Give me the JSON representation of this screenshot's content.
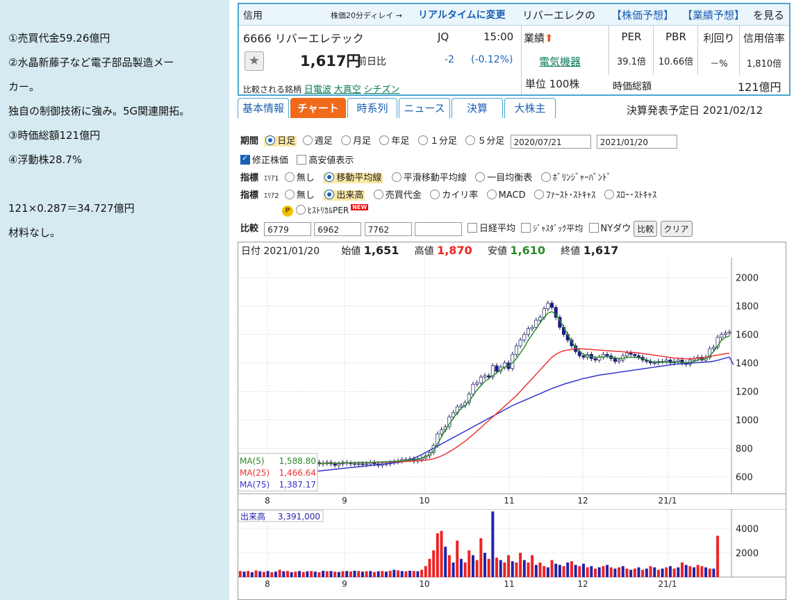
{
  "notes": {
    "line1": "①売買代金59.26億円",
    "line2": "②水晶新藤子など電子部品製造メー",
    "line3": "カー。",
    "line4": "独自の制御技術に強み。5G関連開拓。",
    "line5": "③時価総額121億円",
    "line6": "④浮動株28.7%",
    "line7": "121×0.287＝34.727億円",
    "line8": "材料なし。"
  },
  "header": {
    "shinyo": "信用",
    "delay": "株価20分ディレイ →",
    "realtime": "リアルタイムに変更",
    "river": "リバーエレクの",
    "kabuka_yosou": "【株価予想】",
    "gyouseki_yosou": "【業績予想】",
    "miru": "を見る"
  },
  "stock": {
    "code_name": "6666 リバーエレテック",
    "market": "JQ",
    "time": "15:00",
    "price": "1,617円",
    "zenjitsu": "前日比",
    "change": "-2",
    "change_pct": "(-0.12%)",
    "hikaku_label": "比較される銘柄",
    "peers": [
      "日電波",
      "大真空",
      "シチズン"
    ],
    "gyouseki": "業績",
    "sector": "電気機器",
    "tani": "単位 100株",
    "jika_label": "時価総額",
    "jika_value": "121億円"
  },
  "ratios": [
    {
      "label": "PER",
      "value": "39.1倍"
    },
    {
      "label": "PBR",
      "value": "10.66倍"
    },
    {
      "label": "利回り",
      "value": "－%"
    },
    {
      "label": "信用倍率",
      "value": "1,810倍"
    }
  ],
  "tabs": [
    "基本情報",
    "チャート",
    "時系列",
    "ニュース",
    "決算",
    "大株主"
  ],
  "kessan_date": "決算発表予定日 2021/02/12",
  "controls": {
    "kikan_label": "期間",
    "periods": [
      "日足",
      "週足",
      "月足",
      "年足",
      "１分足",
      "５分足"
    ],
    "date_from": "2020/07/21",
    "date_to": "2021/01/20",
    "shusei": "修正株価",
    "takayasu": "高安値表示",
    "shihyo_label": "指標",
    "area1": "ｴﾘｱ1",
    "area1_opts": [
      "無し",
      "移動平均線",
      "平滑移動平均線",
      "一目均衡表",
      "ﾎﾞﾘﾝｼﾞｬｰﾊﾞﾝﾄﾞ"
    ],
    "area2": "ｴﾘｱ2",
    "area2_opts": [
      "無し",
      "出来高",
      "売買代金",
      "カイリ率",
      "MACD",
      "ﾌｧｰｽﾄ･ｽﾄｷｬｽ",
      "ｽﾛｰ･ｽﾄｷｬｽ"
    ],
    "hist_per": "ﾋｽﾄﾘｶﾙPER",
    "new": "NEW",
    "hikaku_label": "比較",
    "hikaku_codes": [
      "6779",
      "6962",
      "7762",
      ""
    ],
    "nikkei": "日経平均",
    "jasdaq": "ｼﾞｬｽﾀﾞｯｸ平均",
    "nydow": "NYダウ",
    "hikaku_btn": "比較",
    "clear_btn": "クリア"
  },
  "ohlc": {
    "date_label": "日付",
    "date": "2021/01/20",
    "open_label": "始値",
    "open": "1,651",
    "high_label": "高値",
    "high": "1,870",
    "low_label": "安値",
    "low": "1,610",
    "close_label": "終値",
    "close": "1,617"
  },
  "colors": {
    "up_candle": "#ffffff",
    "down_candle": "#1a1a9a",
    "ma5": "#2a8a2a",
    "ma25": "#e33",
    "ma75": "#33c",
    "vol_up": "#e22",
    "vol_down": "#22a",
    "accent": "#f06a1a"
  },
  "chart_data": [
    {
      "type": "candlestick",
      "title": "",
      "ylim": [
        480,
        2130
      ],
      "yticks": [
        600,
        800,
        1000,
        1200,
        1400,
        1600,
        1800,
        2000
      ],
      "xticks": [
        "8",
        "9",
        "10",
        "11",
        "12",
        "21/1"
      ],
      "legend": [
        {
          "label": "MA(5)",
          "value": "1,588.80"
        },
        {
          "label": "MA(25)",
          "value": "1,466.64"
        },
        {
          "label": "MA(75)",
          "value": "1,387.17"
        }
      ],
      "closes": [
        680,
        690,
        700,
        695,
        700,
        705,
        690,
        700,
        710,
        700,
        690,
        680,
        695,
        700,
        690,
        700,
        690,
        680,
        690,
        700,
        690,
        695,
        700,
        690,
        680,
        690,
        700,
        695,
        690,
        690,
        690,
        685,
        690,
        700,
        690,
        680,
        690,
        690,
        700,
        705,
        710,
        720,
        720,
        725,
        710,
        720,
        730,
        745,
        770,
        820,
        900,
        930,
        950,
        1020,
        1050,
        1090,
        1100,
        1120,
        1180,
        1250,
        1260,
        1300,
        1310,
        1300,
        1380,
        1340,
        1370,
        1400,
        1360,
        1460,
        1520,
        1560,
        1600,
        1640,
        1650,
        1700,
        1720,
        1780,
        1820,
        1790,
        1720,
        1650,
        1600,
        1560,
        1520,
        1480,
        1450,
        1440,
        1460,
        1430,
        1420,
        1440,
        1460,
        1450,
        1430,
        1410,
        1420,
        1450,
        1470,
        1460,
        1450,
        1440,
        1420,
        1410,
        1400,
        1400,
        1410,
        1410,
        1420,
        1400,
        1410,
        1420,
        1400,
        1390,
        1420,
        1430,
        1440,
        1420,
        1440,
        1500,
        1510,
        1580,
        1600,
        1610,
        1617
      ],
      "ma5": [
        660,
        665,
        670,
        675,
        680,
        685,
        690,
        692,
        695,
        697,
        698,
        699,
        700,
        700,
        700,
        698,
        696,
        695,
        694,
        693,
        692,
        692,
        693,
        693,
        694,
        695,
        696,
        697,
        698,
        698,
        699,
        700,
        700,
        701,
        702,
        703,
        704,
        705,
        706,
        708,
        710,
        712,
        714,
        716,
        720,
        725,
        730,
        740,
        755,
        780,
        830,
        880,
        930,
        970,
        1010,
        1050,
        1080,
        1100,
        1130,
        1170,
        1210,
        1240,
        1270,
        1290,
        1310,
        1330,
        1350,
        1370,
        1380,
        1400,
        1430,
        1470,
        1510,
        1560,
        1600,
        1640,
        1680,
        1720,
        1750,
        1760,
        1740,
        1700,
        1650,
        1600,
        1550,
        1510,
        1480,
        1460,
        1450,
        1445,
        1440,
        1440,
        1442,
        1445,
        1440,
        1435,
        1430,
        1432,
        1438,
        1440,
        1440,
        1436,
        1430,
        1420,
        1412,
        1406,
        1405,
        1404,
        1406,
        1405,
        1404,
        1406,
        1404,
        1400,
        1405,
        1410,
        1420,
        1425,
        1430,
        1450,
        1480,
        1520,
        1560,
        1580,
        1589
      ],
      "ma25": [
        650,
        652,
        655,
        658,
        660,
        663,
        666,
        668,
        670,
        672,
        674,
        676,
        678,
        680,
        682,
        684,
        686,
        688,
        690,
        691,
        692,
        693,
        694,
        694,
        695,
        695,
        696,
        697,
        697,
        698,
        698,
        699,
        699,
        700,
        700,
        701,
        701,
        702,
        703,
        704,
        705,
        706,
        707,
        708,
        710,
        712,
        714,
        717,
        721,
        726,
        735,
        746,
        760,
        775,
        792,
        810,
        830,
        850,
        872,
        895,
        920,
        945,
        970,
        995,
        1020,
        1045,
        1070,
        1095,
        1120,
        1145,
        1170,
        1200,
        1230,
        1260,
        1290,
        1320,
        1350,
        1380,
        1410,
        1440,
        1460,
        1475,
        1485,
        1490,
        1495,
        1500,
        1500,
        1498,
        1496,
        1494,
        1492,
        1490,
        1488,
        1486,
        1484,
        1482,
        1480,
        1478,
        1476,
        1474,
        1472,
        1470,
        1466,
        1462,
        1458,
        1454,
        1450,
        1446,
        1442,
        1438,
        1434,
        1432,
        1430,
        1428,
        1428,
        1430,
        1432,
        1435,
        1440,
        1445,
        1450,
        1455,
        1460,
        1465,
        1467
      ],
      "ma75": [
        580,
        583,
        586,
        589,
        592,
        595,
        598,
        601,
        604,
        607,
        610,
        613,
        616,
        619,
        622,
        625,
        628,
        631,
        634,
        637,
        640,
        643,
        646,
        649,
        652,
        655,
        658,
        661,
        664,
        667,
        670,
        673,
        676,
        679,
        682,
        685,
        688,
        691,
        694,
        697,
        700,
        705,
        712,
        720,
        730,
        742,
        755,
        770,
        785,
        800,
        815,
        830,
        845,
        860,
        875,
        890,
        905,
        920,
        935,
        950,
        965,
        980,
        995,
        1010,
        1025,
        1040,
        1055,
        1070,
        1085,
        1100,
        1112,
        1124,
        1136,
        1148,
        1160,
        1172,
        1184,
        1196,
        1208,
        1220,
        1230,
        1240,
        1250,
        1258,
        1266,
        1274,
        1282,
        1290,
        1296,
        1302,
        1308,
        1314,
        1318,
        1322,
        1326,
        1330,
        1334,
        1338,
        1342,
        1346,
        1350,
        1354,
        1358,
        1362,
        1366,
        1370,
        1374,
        1378,
        1382,
        1386,
        1390,
        1392,
        1394,
        1396,
        1398,
        1400,
        1402,
        1404,
        1406,
        1408,
        1412,
        1418,
        1426,
        1434,
        1440,
        1387
      ]
    },
    {
      "type": "bar",
      "title": "出来高",
      "label": "出来高",
      "value": "3,391,000",
      "ylim": [
        0,
        5600
      ],
      "yticks": [
        2000,
        4000
      ],
      "xticks": [
        "8",
        "9",
        "10",
        "11",
        "12",
        "21/1"
      ],
      "values": [
        500,
        450,
        500,
        400,
        550,
        480,
        420,
        500,
        400,
        450,
        600,
        480,
        500,
        400,
        450,
        500,
        420,
        480,
        500,
        450,
        400,
        520,
        480,
        500,
        450,
        420,
        480,
        500,
        460,
        520,
        500,
        450,
        480,
        500,
        420,
        480,
        500,
        450,
        520,
        600,
        550,
        500,
        480,
        520,
        500,
        480,
        600,
        900,
        1500,
        2200,
        3600,
        3800,
        2500,
        1800,
        1200,
        3000,
        1500,
        1200,
        2200,
        1800,
        1400,
        3200,
        2000,
        1500,
        5400,
        1600,
        1400,
        1200,
        1800,
        1300,
        1200,
        2000,
        1400,
        1200,
        1800,
        1000,
        1200,
        900,
        800,
        1400,
        1100,
        1000,
        900,
        1200,
        1300,
        1000,
        900,
        1100,
        800,
        900,
        700,
        800,
        900,
        1000,
        800,
        700,
        800,
        900,
        700,
        600,
        700,
        800,
        600,
        700,
        900,
        800,
        600,
        700,
        800,
        900,
        700,
        800,
        1200,
        1000,
        900,
        800,
        1000,
        900,
        800,
        700,
        700,
        3400
      ],
      "colors_up": [
        1,
        0,
        1,
        0,
        1,
        0,
        1,
        0,
        1,
        0,
        1,
        0,
        1,
        0,
        1,
        0,
        1,
        0,
        1,
        0,
        1,
        0,
        1,
        0,
        1,
        0,
        1,
        0,
        1,
        0,
        1,
        0,
        1,
        0,
        1,
        0,
        1,
        0,
        1,
        0,
        1,
        0,
        1,
        0,
        1,
        0,
        1,
        1,
        1,
        1,
        1,
        1,
        0,
        1,
        0,
        1,
        0,
        1,
        1,
        0,
        1,
        1,
        0,
        1,
        0,
        1,
        0,
        1,
        1,
        0,
        1,
        1,
        0,
        1,
        1,
        0,
        1,
        1,
        0,
        1,
        0,
        0,
        1,
        0,
        1,
        0,
        1,
        0,
        1,
        0,
        1,
        0,
        1,
        0,
        1,
        0,
        1,
        0,
        1,
        0,
        1,
        0,
        1,
        0,
        1,
        0,
        1,
        0,
        1,
        0,
        1,
        0,
        1,
        0,
        1,
        0,
        1,
        1,
        0,
        1,
        0,
        1,
        0
      ]
    }
  ]
}
